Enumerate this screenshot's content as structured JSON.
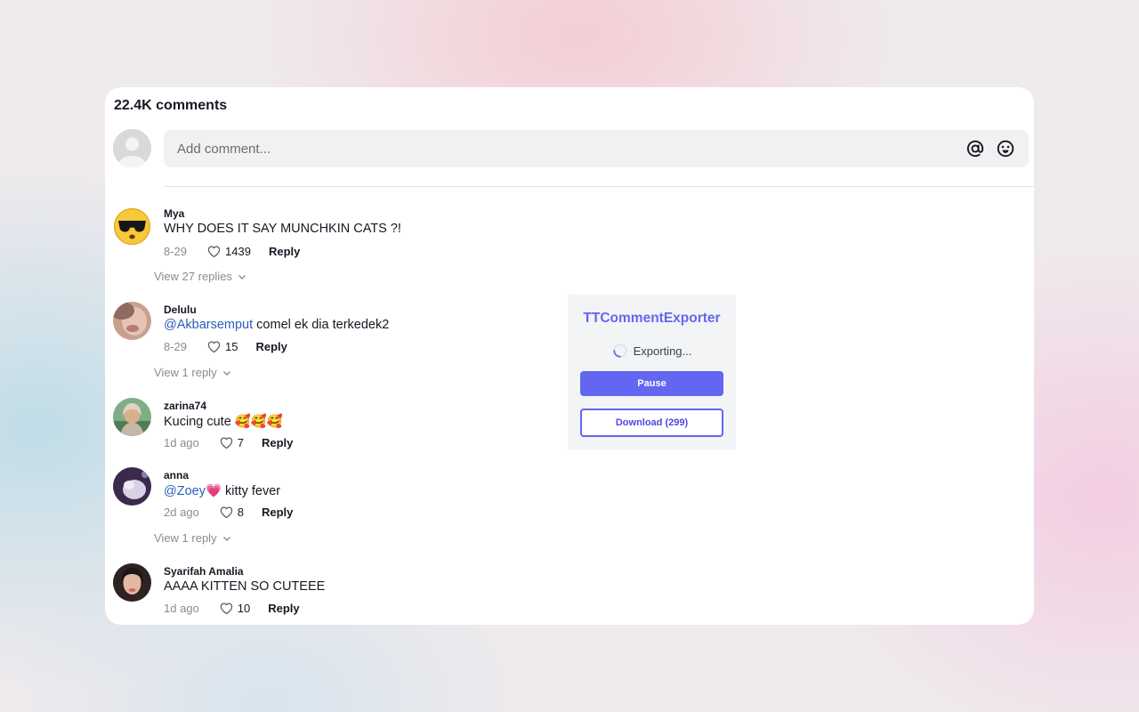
{
  "header": {
    "title": "22.4K comments"
  },
  "composer": {
    "placeholder": "Add comment..."
  },
  "comments": [
    {
      "username": "Mya",
      "text": "WHY DOES IT SAY MUNCHKIN CATS ?!",
      "date": "8-29",
      "likes": "1439",
      "reply_label": "Reply",
      "view_replies": "View 27 replies"
    },
    {
      "username": "Delulu",
      "mention": "@Akbarsemput",
      "text": " comel ek dia terkedek2",
      "date": "8-29",
      "likes": "15",
      "reply_label": "Reply",
      "view_replies": "View 1 reply"
    },
    {
      "username": "zarina74",
      "text": "Kucing cute 🥰🥰🥰",
      "date": "1d ago",
      "likes": "7",
      "reply_label": "Reply"
    },
    {
      "username": "anna",
      "mention": "@Zoey",
      "text": "💗 kitty fever",
      "date": "2d ago",
      "likes": "8",
      "reply_label": "Reply",
      "view_replies": "View 1 reply"
    },
    {
      "username": "Syarifah Amalia",
      "text": "AAAA KITTEN SO CUTEEE",
      "date": "1d ago",
      "likes": "10",
      "reply_label": "Reply"
    }
  ],
  "exporter": {
    "title": "TTCommentExporter",
    "status": "Exporting...",
    "pause_label": "Pause",
    "download_label": "Download (299)"
  },
  "icons": {
    "mention": "at-sign-icon",
    "emoji": "smiley-icon",
    "like": "heart-outline-icon",
    "expand": "chevron-down-icon",
    "loading": "spinner-icon"
  },
  "colors": {
    "accent": "#6366f1",
    "mention": "#2b5db9",
    "text": "#161823",
    "muted": "#8a8b91"
  }
}
